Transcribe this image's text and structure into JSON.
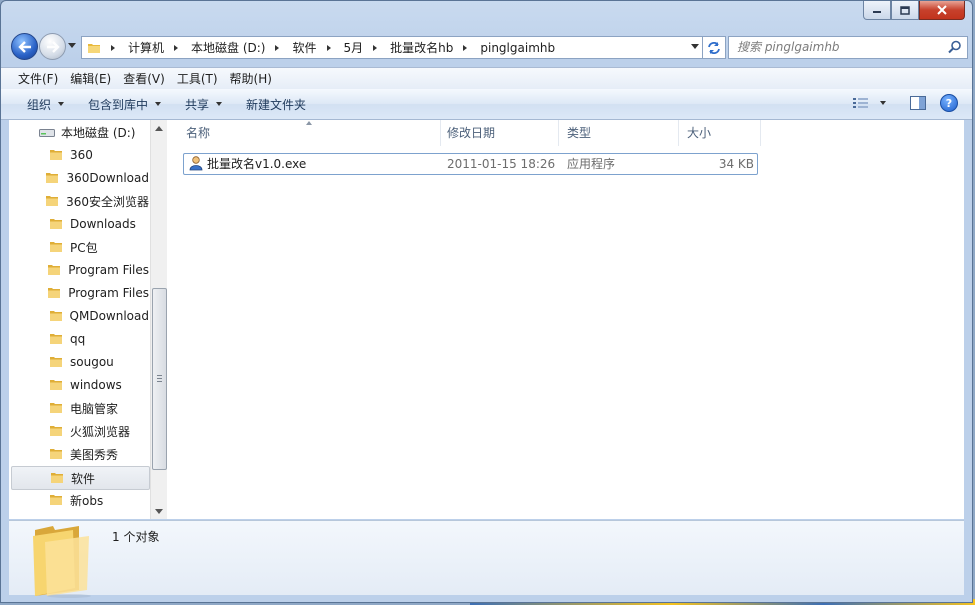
{
  "window": {
    "icons": {
      "minimize": "minimize-icon",
      "maximize": "maximize-icon",
      "close": "close-icon"
    }
  },
  "address": {
    "crumbs": [
      "计算机",
      "本地磁盘 (D:)",
      "软件",
      "5月",
      "批量改名hb",
      "pinglgaimhb"
    ],
    "search_placeholder": "搜索 pinglgaimhb"
  },
  "menubar": {
    "items": [
      "文件(F)",
      "编辑(E)",
      "查看(V)",
      "工具(T)",
      "帮助(H)"
    ]
  },
  "toolbar": {
    "organize": "组织",
    "include_in_library": "包含到库中",
    "share": "共享",
    "new_folder": "新建文件夹",
    "help": "?"
  },
  "navpane": {
    "drive_label": "本地磁盘 (D:)",
    "folders": [
      "360",
      "360Download",
      "360安全浏览器",
      "Downloads",
      "PC包",
      "Program Files",
      "Program Files",
      "QMDownload",
      "qq",
      "sougou",
      "windows",
      "电脑管家",
      "火狐浏览器",
      "美图秀秀",
      "软件",
      "新obs"
    ],
    "selected_folder": "软件"
  },
  "content": {
    "columns": {
      "name": "名称",
      "date": "修改日期",
      "type": "类型",
      "size": "大小"
    },
    "files": [
      {
        "name": "批量改名v1.0.exe",
        "date": "2011-01-15 18:26",
        "type": "应用程序",
        "size": "34 KB"
      }
    ]
  },
  "details": {
    "count": "1 个对象"
  },
  "colors": {
    "accent": "#2a62c7",
    "folder": "#f2c94c",
    "selection_border": "#7da2ce"
  }
}
